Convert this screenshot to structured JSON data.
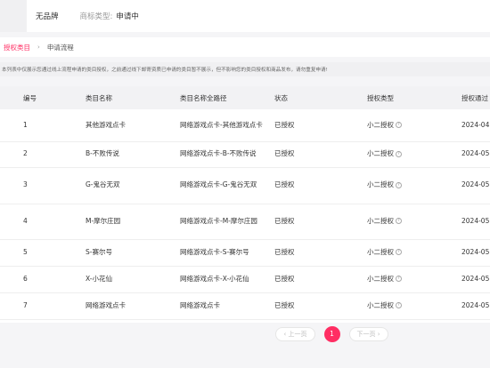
{
  "header": {
    "brand_name": "无品牌",
    "trademark_type_label": "商标类型:",
    "trademark_type_value": "申请中"
  },
  "tabs": [
    {
      "label": "授权类目"
    },
    {
      "label": "申请流程"
    }
  ],
  "tab_separator": "›",
  "notice": "本列表中仅展示您通过线上流程申请的类目授权，之前通过线下邮寄资质已申请的类目暂不展示，但不影响您的类目授权和商品发布，请勿重复申请!",
  "table": {
    "columns": [
      "编号",
      "类目名称",
      "类目名称全路径",
      "状态",
      "授权类型",
      "授权通过"
    ],
    "rows": [
      {
        "id": "1",
        "name": "其他游戏点卡",
        "path": "网络游戏点卡-其他游戏点卡",
        "status": "已授权",
        "auth_type": "小二授权",
        "date": "2024-04"
      },
      {
        "id": "2",
        "name": "B-不败传说",
        "path": "网络游戏点卡-B-不败传说",
        "status": "已授权",
        "auth_type": "小二授权",
        "date": "2024-05"
      },
      {
        "id": "3",
        "name": "G-鬼谷无双",
        "path": "网络游戏点卡-G-鬼谷无双",
        "status": "已授权",
        "auth_type": "小二授权",
        "date": "2024-05"
      },
      {
        "id": "4",
        "name": "M-摩尔庄园",
        "path": "网络游戏点卡-M-摩尔庄园",
        "status": "已授权",
        "auth_type": "小二授权",
        "date": "2024-05"
      },
      {
        "id": "5",
        "name": "S-赛尔号",
        "path": "网络游戏点卡-S-赛尔号",
        "status": "已授权",
        "auth_type": "小二授权",
        "date": "2024-05"
      },
      {
        "id": "6",
        "name": "X-小花仙",
        "path": "网络游戏点卡-X-小花仙",
        "status": "已授权",
        "auth_type": "小二授权",
        "date": "2024-05"
      },
      {
        "id": "7",
        "name": "网络游戏点卡",
        "path": "网络游戏点卡",
        "status": "已授权",
        "auth_type": "小二授权",
        "date": "2024-05"
      }
    ],
    "help_icon": "question-circle-icon",
    "help_glyph": "?"
  },
  "pagination": {
    "prev_label": "‹ 上一页",
    "current_page": "1",
    "next_label": "下一页 ›"
  },
  "colors": {
    "accent": "#ff2e63",
    "header_bg": "#f2f2f4",
    "page_bg": "#f5f5f7"
  }
}
